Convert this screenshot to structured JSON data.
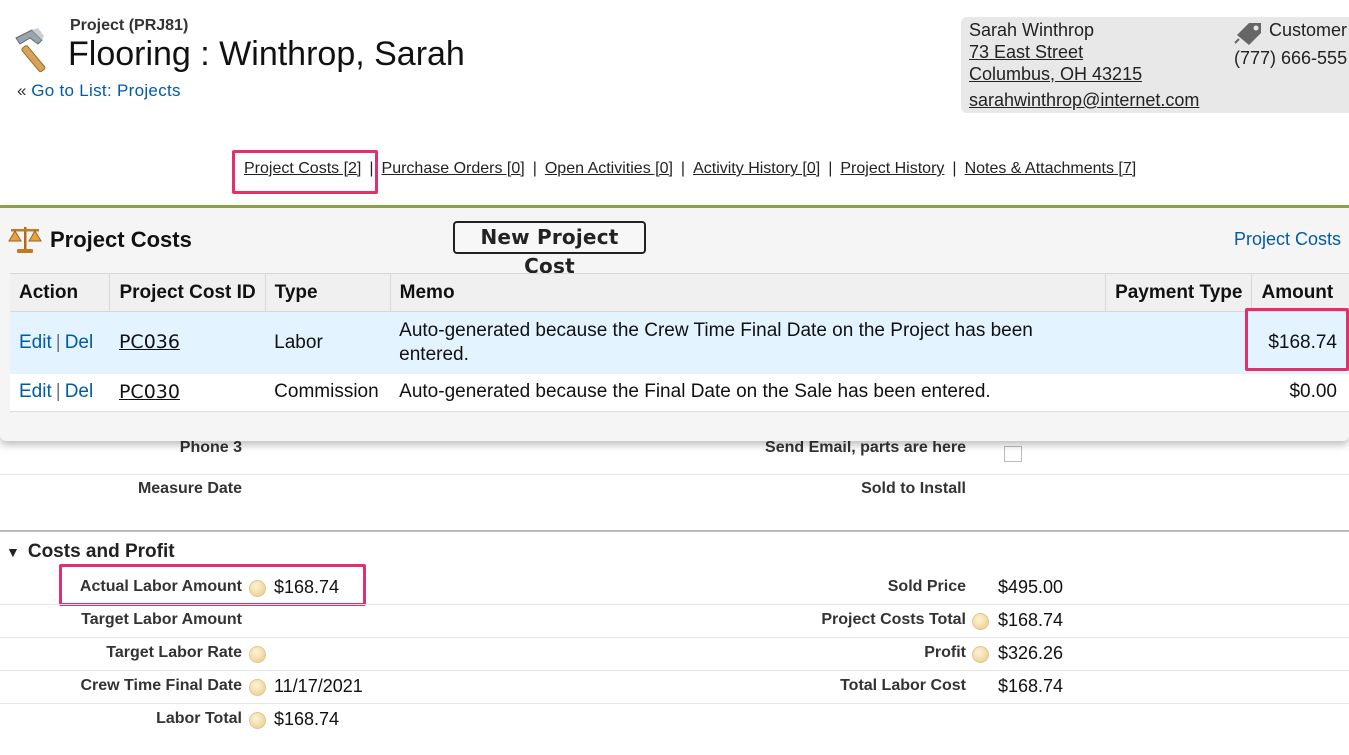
{
  "header": {
    "record_type": "Project (PRJ81)",
    "title": "Flooring : Winthrop, Sarah",
    "back_prefix": "«",
    "back_link": "Go to List: Projects"
  },
  "contact": {
    "name": "Sarah Winthrop",
    "street": "73 East Street",
    "city": "Columbus, OH 43215",
    "email": "sarahwinthrop@internet.com",
    "type": "Customer",
    "phone": "(777) 666-555"
  },
  "related_links": [
    {
      "label": "Project Costs [2]"
    },
    {
      "label": "Purchase Orders [0]"
    },
    {
      "label": "Open Activities [0]"
    },
    {
      "label": "Activity History [0]"
    },
    {
      "label": "Project History"
    },
    {
      "label": "Notes & Attachments [7]"
    }
  ],
  "related_sep": "|",
  "project_costs": {
    "title": "Project Costs",
    "new_button": "New Project Cost",
    "link": "Project Costs",
    "columns": [
      "Action",
      "Project Cost ID",
      "Type",
      "Memo",
      "Payment Type",
      "Amount"
    ],
    "rows": [
      {
        "edit": "Edit",
        "sep": "|",
        "del": "Del",
        "id": "PC036",
        "type": "Labor",
        "memo": "Auto-generated because the Crew Time Final Date on the Project has been entered.",
        "payment_type": "",
        "amount": "$168.74"
      },
      {
        "edit": "Edit",
        "sep": "|",
        "del": "Del",
        "id": "PC030",
        "type": "Commission",
        "memo": "Auto-generated because the Final Date on the Sale has been entered.",
        "payment_type": "",
        "amount": "$0.00"
      }
    ]
  },
  "details_top": {
    "phone3_label": "Phone 3",
    "send_email_label": "Send Email, parts are here",
    "measure_date_label": "Measure Date",
    "sold_to_install_label": "Sold to Install"
  },
  "costs_profit": {
    "section_title": "Costs and Profit",
    "left": [
      {
        "label": "Actual Labor Amount",
        "value": "$168.74"
      },
      {
        "label": "Target Labor Amount",
        "value": ""
      },
      {
        "label": "Target Labor Rate",
        "value": ""
      },
      {
        "label": "Crew Time Final Date",
        "value": "11/17/2021"
      },
      {
        "label": "Labor Total",
        "value": "$168.74"
      }
    ],
    "right": [
      {
        "label": "Sold Price",
        "value": "$495.00"
      },
      {
        "label": "Project Costs Total",
        "value": "$168.74"
      },
      {
        "label": "Profit",
        "value": "$326.26"
      },
      {
        "label": "Total Labor Cost",
        "value": "$168.74"
      }
    ]
  }
}
